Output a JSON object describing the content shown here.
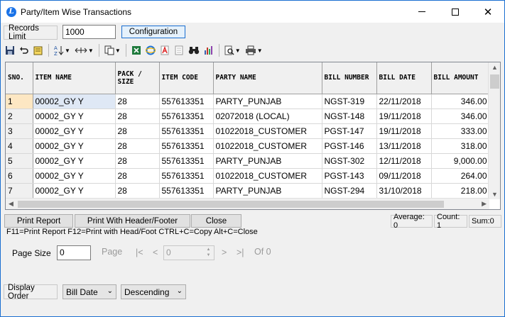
{
  "window": {
    "title": "Party/Item Wise Transactions",
    "app_icon_letter": "L",
    "close_glyph": "✕"
  },
  "records": {
    "label": "Records Limit",
    "value": "1000",
    "config_label": "Configuration"
  },
  "toolbar": {
    "icons": [
      "save-icon",
      "undo-icon",
      "note-icon",
      "sort-az-icon",
      "expand-columns-icon",
      "copy-icon",
      "excel-icon",
      "internet-explorer-icon",
      "pdf-icon",
      "document-icon",
      "binoculars-icon",
      "bar-chart-icon",
      "print-preview-icon",
      "printer-icon"
    ]
  },
  "grid": {
    "columns": [
      "SNO.",
      "ITEM NAME",
      "PACK / SIZE",
      "ITEM CODE",
      "PARTY NAME",
      "BILL NUMBER",
      "BILL DATE",
      "BILL AMOUNT"
    ],
    "rows": [
      [
        "1",
        "00002_GY Y",
        "28",
        "557613351",
        "PARTY_PUNJAB",
        "NGST-319",
        "22/11/2018",
        "346.00"
      ],
      [
        "2",
        "00002_GY Y",
        "28",
        "557613351",
        "02072018 (LOCAL)",
        "NGST-148",
        "19/11/2018",
        "346.00"
      ],
      [
        "3",
        "00002_GY Y",
        "28",
        "557613351",
        "01022018_CUSTOMER",
        "PGST-147",
        "19/11/2018",
        "333.00"
      ],
      [
        "4",
        "00002_GY Y",
        "28",
        "557613351",
        "01022018_CUSTOMER",
        "PGST-146",
        "13/11/2018",
        "318.00"
      ],
      [
        "5",
        "00002_GY Y",
        "28",
        "557613351",
        "PARTY_PUNJAB",
        "NGST-302",
        "12/11/2018",
        "9,000.00"
      ],
      [
        "6",
        "00002_GY Y",
        "28",
        "557613351",
        "01022018_CUSTOMER",
        "PGST-143",
        "09/11/2018",
        "264.00"
      ],
      [
        "7",
        "00002_GY Y",
        "28",
        "557613351",
        "PARTY_PUNJAB",
        "NGST-294",
        "31/10/2018",
        "218.00"
      ]
    ]
  },
  "actions": {
    "print_report": "Print Report",
    "print_header": "Print With Header/Footer",
    "close": "Close"
  },
  "stats": {
    "average": "Average: 0",
    "count": "Count: 1",
    "sum": "Sum:0"
  },
  "shortcuts": "F11=Print Report  F12=Print with Head/Foot  CTRL+C=Copy  Alt+C=Close",
  "pager": {
    "page_size_label": "Page Size",
    "page_size": "0",
    "page_label": "Page",
    "first": "|<",
    "prev": "<",
    "page_value": "0",
    "next": ">",
    "last": ">|",
    "of": "Of 0"
  },
  "sort": {
    "label": "Display Order",
    "field": "Bill Date",
    "direction": "Descending"
  }
}
